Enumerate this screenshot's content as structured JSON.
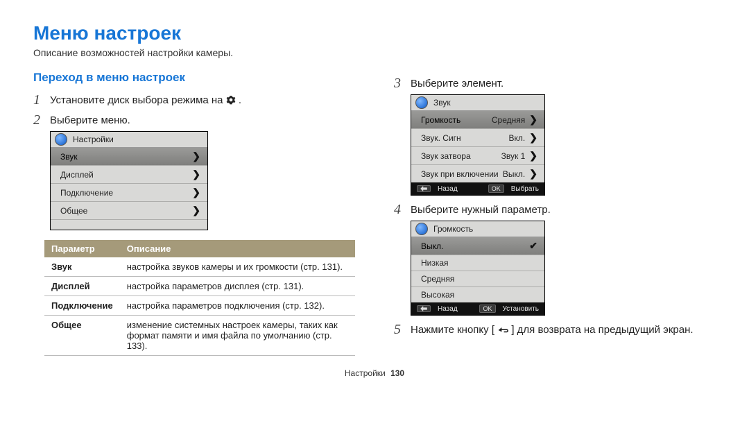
{
  "title": "Меню настроек",
  "subtitle": "Описание возможностей настройки камеры.",
  "section_heading": "Переход в меню настроек",
  "steps": {
    "s1_pre": "Установите диск выбора режима на ",
    "s1_post": " .",
    "s2": "Выберите меню.",
    "s3": "Выберите элемент.",
    "s4": "Выберите нужный параметр.",
    "s5_pre": "Нажмите кнопку [",
    "s5_post": "] для возврата на предыдущий экран."
  },
  "widget1": {
    "header": "Настройки",
    "rows": [
      "Звук",
      "Дисплей",
      "Подключение",
      "Общее"
    ]
  },
  "widget2": {
    "header": "Звук",
    "rows": [
      {
        "label": "Громкость",
        "value": "Средняя"
      },
      {
        "label": "Звук. Сигн",
        "value": "Вкл."
      },
      {
        "label": "Звук затвора",
        "value": "Звук 1"
      },
      {
        "label": "Звук при включении",
        "value": "Выкл."
      }
    ],
    "foot_back": "Назад",
    "foot_ok_key": "OK",
    "foot_ok": "Выбрать"
  },
  "widget3": {
    "header": "Громкость",
    "rows": [
      "Выкл.",
      "Низкая",
      "Средняя",
      "Высокая"
    ],
    "foot_back": "Назад",
    "foot_ok_key": "OK",
    "foot_ok": "Установить"
  },
  "table": {
    "col1": "Параметр",
    "col2": "Описание",
    "rows": [
      {
        "p": "Звук",
        "d": "настройка звуков камеры и их громкости (стр. 131)."
      },
      {
        "p": "Дисплей",
        "d": "настройка параметров дисплея (стр. 131)."
      },
      {
        "p": "Подключение",
        "d": "настройка параметров подключения (стр. 132)."
      },
      {
        "p": "Общее",
        "d": "изменение системных настроек камеры, таких как формат памяти и имя файла по умолчанию (стр. 133)."
      }
    ]
  },
  "footer": {
    "label": "Настройки",
    "page": "130"
  }
}
